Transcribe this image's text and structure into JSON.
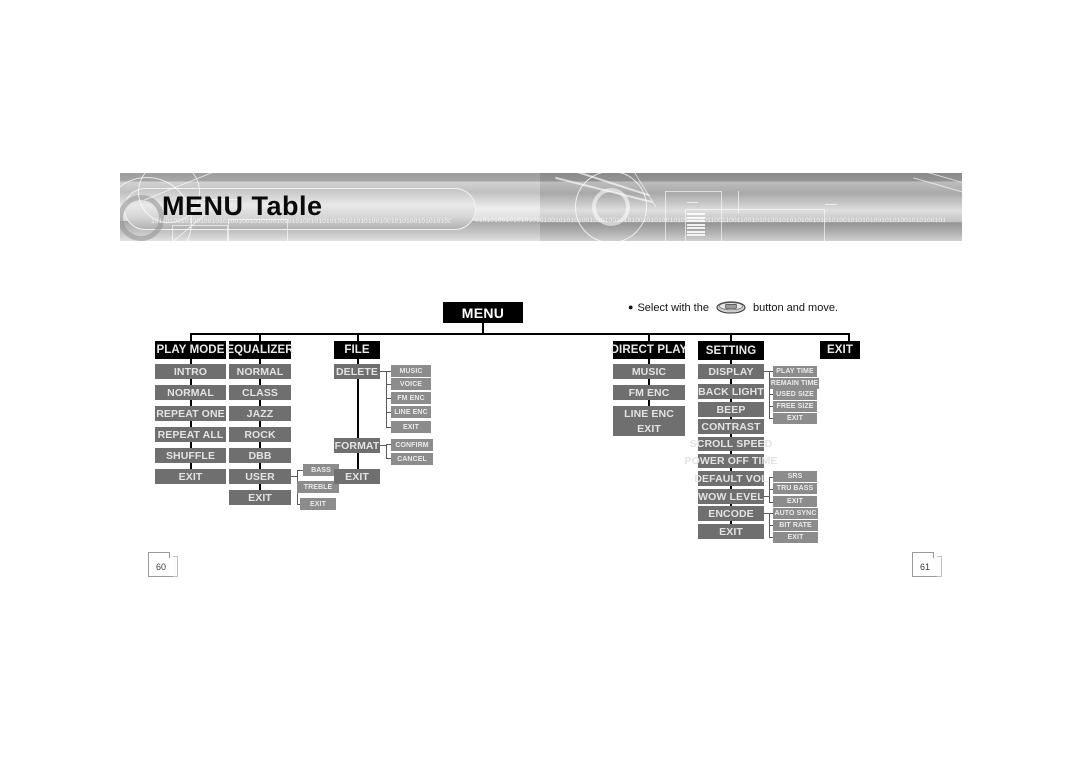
{
  "banner": {
    "title": "MENU Table",
    "binary_strip_left": "10110100101001001010100100101010010101010010101010010101010010010101001010101001010101001011",
    "binary_strip_right": "0101010010101010101001010101001010100101010010101001010101100110011001100101010010101010010101010010101010010101001010100101010101"
  },
  "note": {
    "bullet": "●",
    "text_before": "Select with the",
    "icon": "joystick-button-icon",
    "text_after": "button and move."
  },
  "menu": {
    "root_label": "MENU",
    "columns": [
      {
        "id": "play-mode",
        "category": "PLAY MODE",
        "items": [
          {
            "label": "INTRO"
          },
          {
            "label": "NORMAL"
          },
          {
            "label": "REPEAT ONE"
          },
          {
            "label": "REPEAT ALL"
          },
          {
            "label": "SHUFFLE"
          },
          {
            "label": "EXIT"
          }
        ]
      },
      {
        "id": "equalizer",
        "category": "EQUALIZER",
        "items": [
          {
            "label": "NORMAL"
          },
          {
            "label": "CLASS"
          },
          {
            "label": "JAZZ"
          },
          {
            "label": "ROCK"
          },
          {
            "label": "DBB"
          },
          {
            "label": "USER",
            "children": [
              "BASS",
              "TREBLE",
              "EXIT"
            ]
          },
          {
            "label": "EXIT"
          }
        ]
      },
      {
        "id": "file",
        "category": "FILE",
        "items": [
          {
            "label": "DELETE",
            "children": [
              "MUSIC",
              "VOICE",
              "FM ENC",
              "LINE ENC",
              "EXIT"
            ]
          },
          {
            "label": "FORMAT",
            "children": [
              "CONFIRM",
              "CANCEL"
            ]
          },
          {
            "label": "EXIT"
          }
        ]
      },
      {
        "id": "direct-play",
        "category": "DIRECT PLAY",
        "items": [
          {
            "label": "MUSIC"
          },
          {
            "label": "FM ENC"
          },
          {
            "label": "LINE ENC"
          },
          {
            "label": "EXIT"
          }
        ]
      },
      {
        "id": "setting",
        "category": "SETTING",
        "items": [
          {
            "label": "DISPLAY",
            "children": [
              "PLAY TIME",
              "REMAIN TIME",
              "USED SIZE",
              "FREE SIZE",
              "EXIT"
            ]
          },
          {
            "label": "BACK LIGHT"
          },
          {
            "label": "BEEP"
          },
          {
            "label": "CONTRAST"
          },
          {
            "label": "SCROLL SPEED"
          },
          {
            "label": "POWER OFF TIME"
          },
          {
            "label": "DEFAULT VOL",
            "children": [
              "SRS",
              "TRU BASS",
              "EXIT"
            ]
          },
          {
            "label": "WOW LEVEL"
          },
          {
            "label": "ENCODE",
            "children": [
              "AUTO SYNC",
              "BIT RATE",
              "EXIT"
            ]
          },
          {
            "label": "EXIT"
          }
        ]
      },
      {
        "id": "exit",
        "category": "EXIT",
        "items": []
      }
    ],
    "sub_groups": [
      {
        "id": "equalizer-user-sub",
        "labels": [
          "BASS",
          "TREBLE",
          "EXIT"
        ]
      },
      {
        "id": "file-delete-sub",
        "labels": [
          "MUSIC",
          "VOICE",
          "FM ENC",
          "LINE ENC",
          "EXIT"
        ]
      },
      {
        "id": "file-format-sub",
        "labels": [
          "CONFIRM",
          "CANCEL"
        ]
      },
      {
        "id": "setting-display-sub",
        "labels": [
          "PLAY TIME",
          "REMAIN TIME",
          "USED SIZE",
          "FREE SIZE",
          "EXIT"
        ]
      },
      {
        "id": "setting-vol-sub",
        "labels": [
          "SRS",
          "TRU BASS",
          "EXIT"
        ]
      },
      {
        "id": "setting-encode-sub",
        "labels": [
          "AUTO SYNC",
          "BIT RATE",
          "EXIT"
        ]
      }
    ]
  },
  "footer": {
    "page_left": "60",
    "page_right": "61"
  },
  "colors": {
    "node_root_bg": "#000000",
    "node_item_bg": "#6f6f6f",
    "node_sub_bg": "#8c8c8c",
    "connector": "#000000"
  }
}
